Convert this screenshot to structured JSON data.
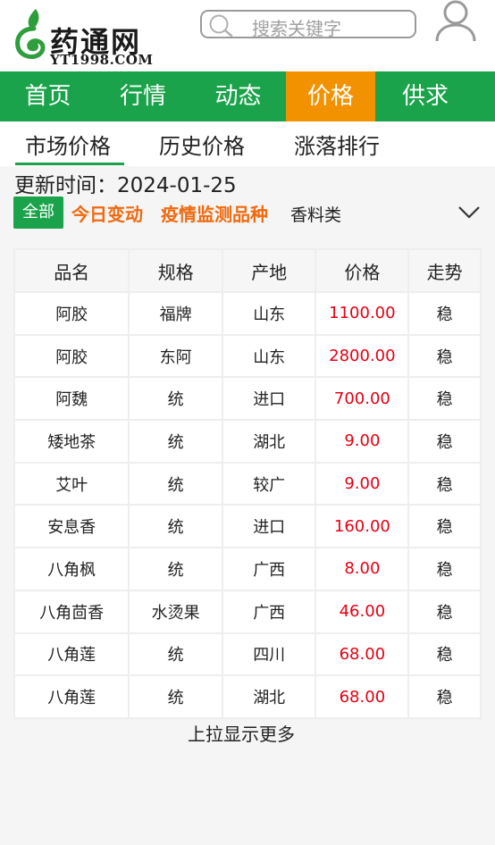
{
  "header": {
    "logo_title": "药通网",
    "logo_sub": "YT1998.COM",
    "search_placeholder": "搜索关键字"
  },
  "nav": {
    "items": [
      {
        "label": "首页",
        "active": false
      },
      {
        "label": "行情",
        "active": false
      },
      {
        "label": "动态",
        "active": false
      },
      {
        "label": "价格",
        "active": true
      },
      {
        "label": "供求",
        "active": false
      }
    ]
  },
  "subtabs": {
    "items": [
      "市场价格",
      "历史价格",
      "涨落排行"
    ],
    "active_index": 0
  },
  "update": {
    "label": "更新时间：",
    "date": "2024-01-25"
  },
  "filters": {
    "all": "全部",
    "today": "今日变动",
    "epidemic": "疫情监测品种",
    "category": "香料类"
  },
  "table": {
    "headers": [
      "品名",
      "规格",
      "产地",
      "价格",
      "走势"
    ],
    "rows": [
      [
        "阿胶",
        "福牌",
        "山东",
        "1100.00",
        "稳"
      ],
      [
        "阿胶",
        "东阿",
        "山东",
        "2800.00",
        "稳"
      ],
      [
        "阿魏",
        "统",
        "进口",
        "700.00",
        "稳"
      ],
      [
        "矮地茶",
        "统",
        "湖北",
        "9.00",
        "稳"
      ],
      [
        "艾叶",
        "统",
        "较广",
        "9.00",
        "稳"
      ],
      [
        "安息香",
        "统",
        "进口",
        "160.00",
        "稳"
      ],
      [
        "八角枫",
        "统",
        "广西",
        "8.00",
        "稳"
      ],
      [
        "八角茴香",
        "水烫果",
        "广西",
        "46.00",
        "稳"
      ],
      [
        "八角莲",
        "统",
        "四川",
        "68.00",
        "稳"
      ],
      [
        "八角莲",
        "统",
        "湖北",
        "68.00",
        "稳"
      ]
    ]
  },
  "footer": {
    "load_more": "上拉显示更多"
  },
  "colors": {
    "brand_green": "#1aa34a",
    "active_orange": "#f39200",
    "filter_orange": "#f06a0f",
    "price_red": "#e60012"
  }
}
